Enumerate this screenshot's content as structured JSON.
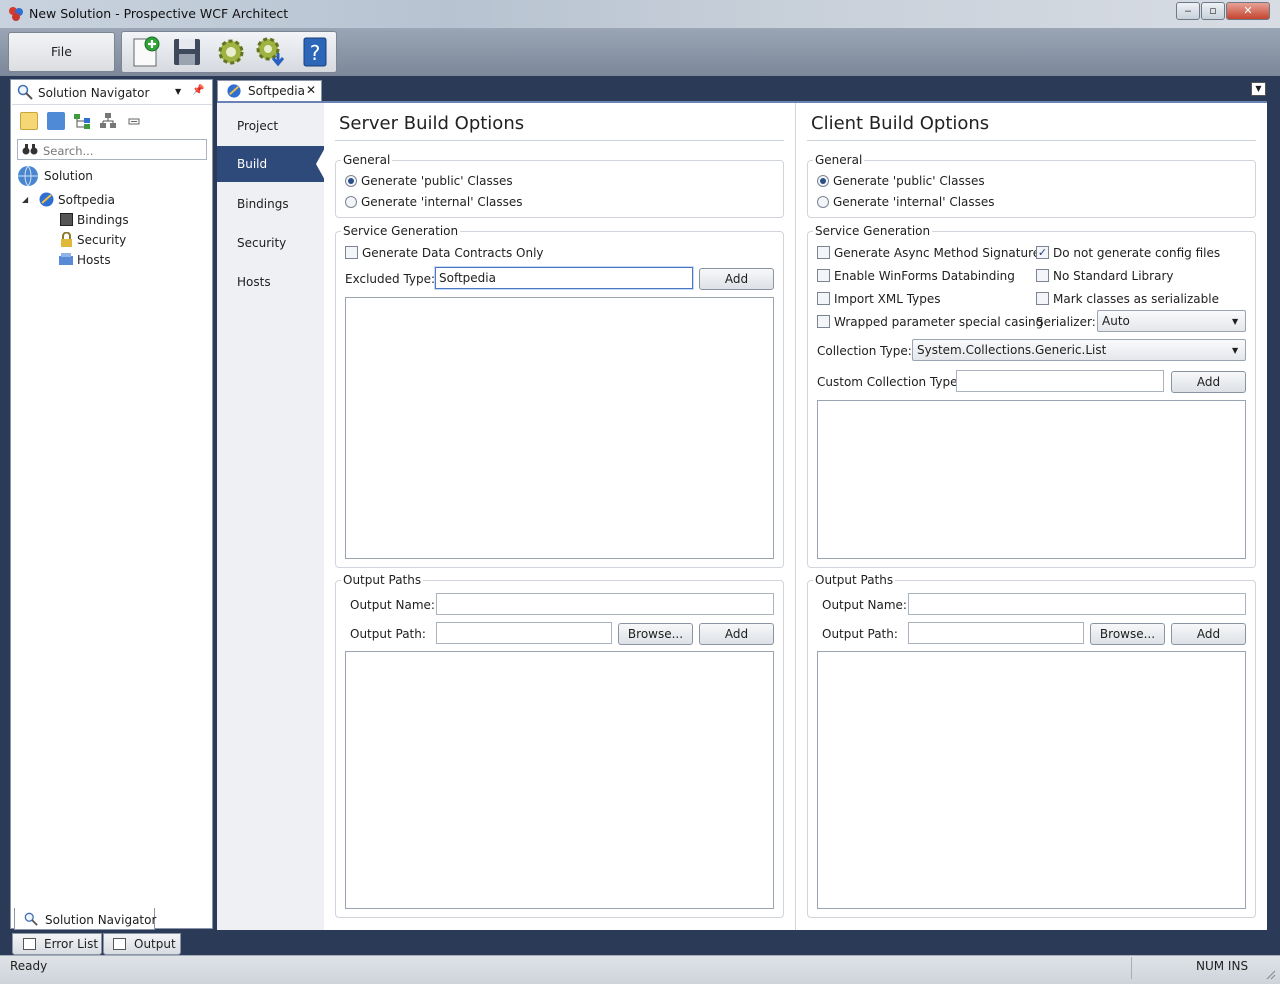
{
  "window": {
    "title": "New Solution - Prospective WCF Architect",
    "minimize": "‒",
    "maximize": "▫",
    "close": "✕"
  },
  "toolbar": {
    "file_label": "File",
    "icons": [
      "new-document-icon",
      "save-icon",
      "build-gear-icon",
      "build-deploy-gear-icon",
      "help-icon"
    ]
  },
  "solution_navigator": {
    "title": "Solution Navigator",
    "pin": "📌",
    "search_placeholder": "Search...",
    "toolbar_icons": [
      "view-icon",
      "folder-icon",
      "hierarchy-icon",
      "network-icon",
      "collapse-icon"
    ],
    "tree": {
      "root": "Solution",
      "project": "Softpedia",
      "expander": "◢",
      "children": [
        "Bindings",
        "Security",
        "Hosts"
      ]
    },
    "bottom_tab": "Solution Navigator"
  },
  "document": {
    "tab_label": "Softpedia",
    "tab_close": "✕",
    "menu_glyph": "▼",
    "nav": [
      "Project",
      "Build",
      "Bindings",
      "Security",
      "Hosts"
    ],
    "selected_nav": "Build"
  },
  "server": {
    "title": "Server Build Options",
    "general": {
      "legend": "General",
      "options": [
        "Generate 'public' Classes",
        "Generate 'internal' Classes"
      ],
      "selected": 0
    },
    "service_generation": {
      "legend": "Service Generation",
      "data_contracts_only": "Generate Data Contracts Only",
      "excluded_type_label": "Excluded Type:",
      "excluded_type_value": "Softpedia",
      "add_label": "Add"
    },
    "output_paths": {
      "legend": "Output Paths",
      "name_label": "Output Name:",
      "name_value": "",
      "path_label": "Output Path:",
      "path_value": "",
      "browse_label": "Browse...",
      "add_label": "Add"
    }
  },
  "client": {
    "title": "Client Build Options",
    "general": {
      "legend": "General",
      "options": [
        "Generate 'public' Classes",
        "Generate 'internal' Classes"
      ],
      "selected": 0
    },
    "service_generation": {
      "legend": "Service Generation",
      "checkboxes": [
        {
          "label": "Generate Async Method Signatures",
          "checked": false
        },
        {
          "label": "Do not generate config files",
          "checked": true
        },
        {
          "label": "Enable WinForms Databinding",
          "checked": false
        },
        {
          "label": "No Standard Library",
          "checked": false
        },
        {
          "label": "Import XML Types",
          "checked": false
        },
        {
          "label": "Mark classes as serializable",
          "checked": false
        },
        {
          "label": "Wrapped parameter special casing",
          "checked": false
        }
      ],
      "check_mark": "✓",
      "serializer_label": "Serializer:",
      "serializer_value": "Auto",
      "collection_type_label": "Collection Type:",
      "collection_type_value": "System.Collections.Generic.List",
      "custom_collection_label": "Custom Collection Type:",
      "custom_collection_value": "",
      "add_label": "Add",
      "dropdown_arrow": "▼"
    },
    "output_paths": {
      "legend": "Output Paths",
      "name_label": "Output Name:",
      "name_value": "",
      "path_label": "Output Path:",
      "path_value": "",
      "browse_label": "Browse...",
      "add_label": "Add"
    }
  },
  "bottom_tabs": [
    "Error List",
    "Output"
  ],
  "status": {
    "text": "Ready",
    "flags": "NUM INS"
  },
  "colors": {
    "selected_nav": "#2e4a7a",
    "chrome_dark": "#2b3b57",
    "accent": "#6b82b4"
  }
}
